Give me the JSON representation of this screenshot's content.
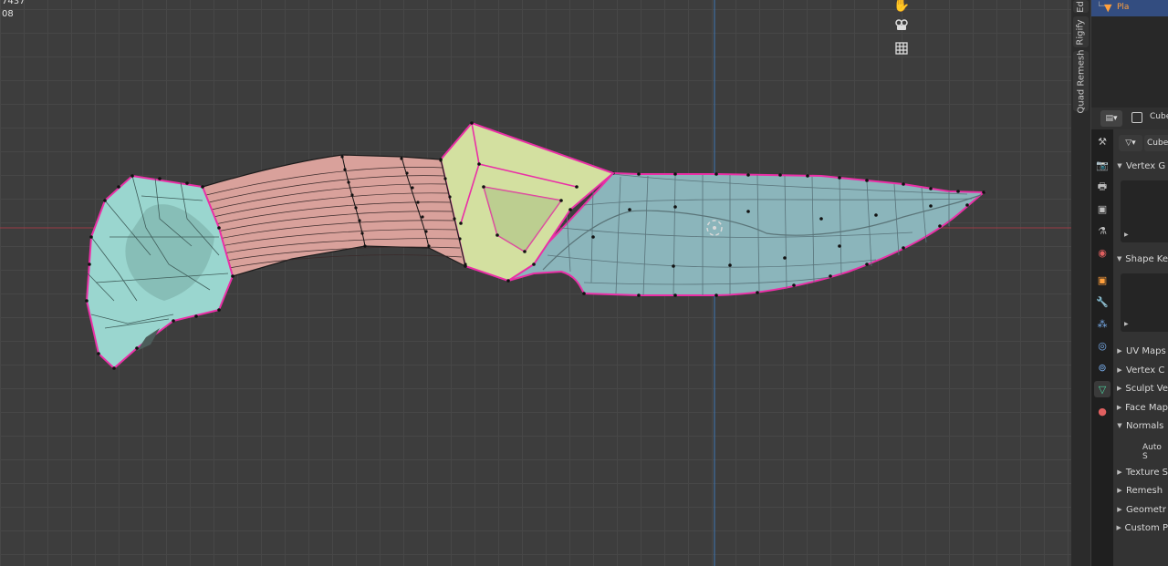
{
  "viewport": {
    "stats": [
      "7437",
      "08"
    ],
    "gizmo_icons": [
      "hand-icon",
      "camera-icon",
      "grid-icon"
    ]
  },
  "vertical_tabs": [
    "Ed",
    "Rigify",
    "Quad Remesh"
  ],
  "outliner": {
    "row_label": "Pla"
  },
  "properties": {
    "header": {
      "object_name": "Cube",
      "data_name": "Cube"
    },
    "sidebar_icons": [
      "tool-icon",
      "render-icon",
      "output-icon",
      "view-layer-icon",
      "scene-icon",
      "world-icon",
      "object-icon",
      "modifier-icon",
      "particles-icon",
      "physics-icon",
      "constraints-icon",
      "data-icon",
      "material-icon"
    ],
    "panels": [
      {
        "label": "Vertex G",
        "expanded": true
      },
      {
        "label": "Shape Ke",
        "expanded": true
      },
      {
        "label": "UV Maps",
        "expanded": false
      },
      {
        "label": "Vertex C",
        "expanded": false
      },
      {
        "label": "Sculpt Ve",
        "expanded": false
      },
      {
        "label": "Face Map",
        "expanded": false
      },
      {
        "label": "Normals",
        "expanded": true
      },
      {
        "label": "Texture S",
        "expanded": false
      },
      {
        "label": "Remesh",
        "expanded": false
      },
      {
        "label": "Geometr",
        "expanded": false
      },
      {
        "label": "Custom P",
        "expanded": false
      }
    ],
    "normals_sub": "Auto S"
  },
  "colors": {
    "blade": "#8bb5bb",
    "handle": "#d9a19b",
    "guard": "#d3e0a0",
    "pommel": "#9ad6cf",
    "edge": "#ea2fa6",
    "selected_row": "#334d80"
  }
}
